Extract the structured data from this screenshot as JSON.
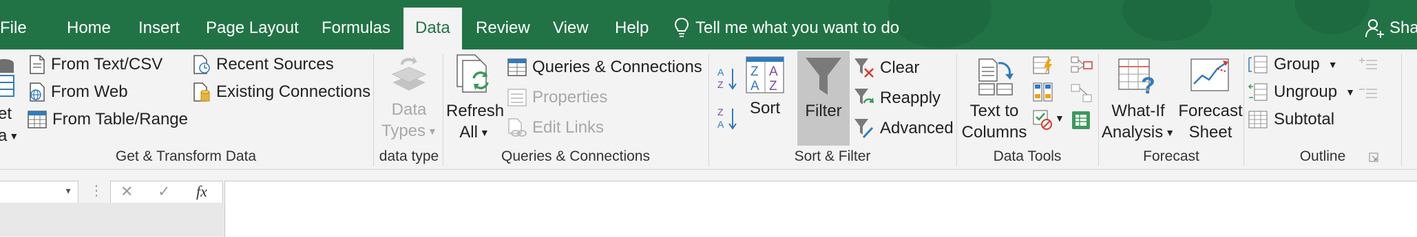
{
  "tabs": {
    "file": "File",
    "home": "Home",
    "insert": "Insert",
    "page_layout": "Page Layout",
    "formulas": "Formulas",
    "data": "Data",
    "review": "Review",
    "view": "View",
    "help": "Help"
  },
  "tell_me": "Tell me what you want to do",
  "share": "Sha",
  "get_transform": {
    "partial_top": "et",
    "partial_bottom": "a",
    "from_text_csv": "From Text/CSV",
    "from_web": "From Web",
    "from_table_range": "From Table/Range",
    "recent_sources": "Recent Sources",
    "existing_connections": "Existing Connections",
    "label": "Get & Transform Data"
  },
  "data_type": {
    "data_types_line1": "Data",
    "data_types_line2": "Types",
    "label": "data type"
  },
  "queries": {
    "refresh_line1": "Refresh",
    "refresh_line2": "All",
    "queries_connections": "Queries & Connections",
    "properties": "Properties",
    "edit_links": "Edit Links",
    "label": "Queries & Connections"
  },
  "sort_filter": {
    "sort": "Sort",
    "filter": "Filter",
    "clear": "Clear",
    "reapply": "Reapply",
    "advanced": "Advanced",
    "label": "Sort & Filter"
  },
  "data_tools": {
    "text_to_line1": "Text to",
    "text_to_line2": "Columns",
    "label": "Data Tools"
  },
  "forecast": {
    "whatif_line1": "What-If",
    "whatif_line2": "Analysis",
    "forecast_line1": "Forecast",
    "forecast_line2": "Sheet",
    "label": "Forecast"
  },
  "outline": {
    "group": "Group",
    "ungroup": "Ungroup",
    "subtotal": "Subtotal",
    "label": "Outline"
  },
  "formula_bar": {
    "cancel": "✕",
    "enter": "✓",
    "fx": "fx"
  },
  "colors": {
    "excel_green": "#217346",
    "ribbon_bg": "#f3f3f3",
    "filter_highlight": "#c6c6c6"
  }
}
